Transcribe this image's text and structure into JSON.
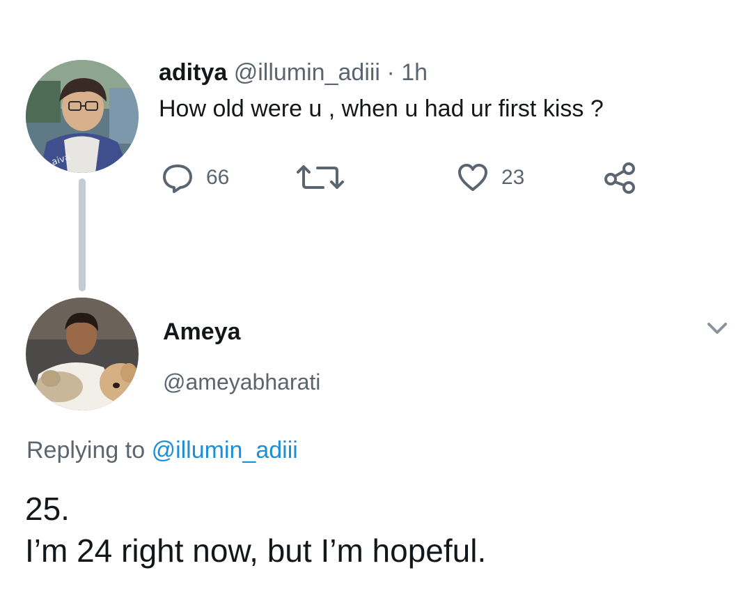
{
  "parent_tweet": {
    "display_name": "aditya",
    "handle": "@illumin_adiii",
    "separator": "·",
    "time": "1h",
    "text": "How old were u , when u had ur first kiss ?",
    "avatar_shirt_text": "aiva",
    "actions": {
      "reply_count": "66",
      "like_count": "23"
    }
  },
  "reply_tweet": {
    "display_name": "Ameya",
    "handle": "@ameyabharati",
    "replying_to_label": "Replying to",
    "replying_to_handle": "@illumin_adiii",
    "text_lines": [
      "25.",
      "I’m 24 right now, but I’m hopeful."
    ]
  },
  "colors": {
    "text_primary": "#14171a",
    "text_secondary": "#5b6570",
    "link": "#1b8fd8",
    "thread_line": "#c4ccd3"
  },
  "icons": {
    "reply": "reply-bubble-icon",
    "retweet": "retweet-icon",
    "like": "heart-icon",
    "share": "share-icon",
    "menu": "chevron-down-icon"
  }
}
